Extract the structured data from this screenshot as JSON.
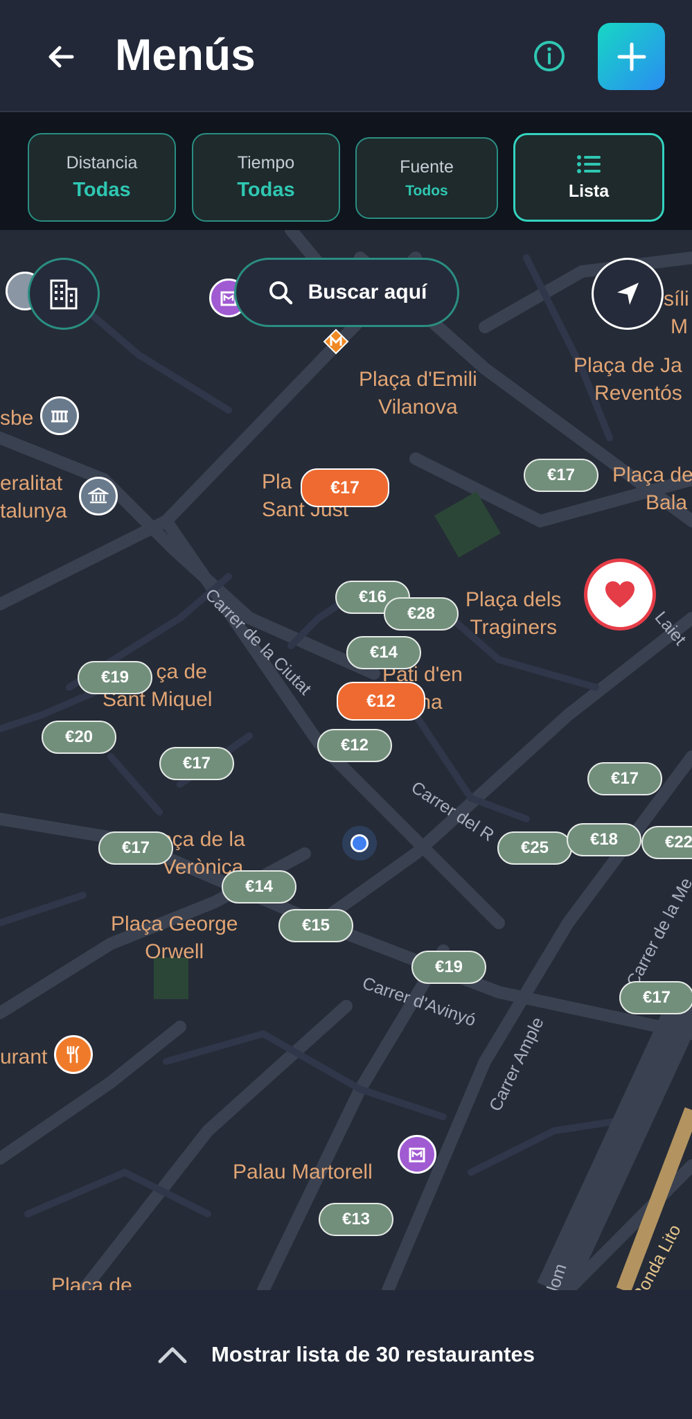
{
  "header": {
    "title": "Menús"
  },
  "filters": [
    {
      "label": "Distancia",
      "value": "Todas"
    },
    {
      "label": "Tiempo",
      "value": "Todas"
    },
    {
      "label": "Fuente",
      "value": "Todos"
    },
    {
      "value": "Lista"
    }
  ],
  "search_here": "Buscar aquí",
  "map_labels": {
    "emili_vilanova_1": "Plaça d'Emili",
    "emili_vilanova_2": "Vilanova",
    "jaume_1": "Plaça de Ja",
    "jaume_2": "Reventós",
    "basilica_1": "síli",
    "basilica_2": "M",
    "sbe": "sbe",
    "generalitat_1": "eralitat",
    "generalitat_2": "talunya",
    "sant_just_1": "Pla",
    "sant_just_2": "Sant Just",
    "balagueret_1": "Plaça de",
    "balagueret_2": "Bala",
    "traginers_1": "Plaça dels",
    "traginers_2": "Traginers",
    "sant_miquel_1": "ça de",
    "sant_miquel_2": "Sant Miquel",
    "pati_1": "Pati d'en",
    "pati_2": "iona",
    "veronica_1": "aça de la",
    "veronica_2": "Verònica",
    "george_orwell_1": "Plaça George",
    "george_orwell_2": "Orwell",
    "restaurant": "urant",
    "palau_martorell": "Palau Martorell",
    "placa_bottom": "Plaça de"
  },
  "street_labels": {
    "ciutat": "Carrer de la Ciutat",
    "regomir": "Carrer del R",
    "avinyo": "Carrer d'Avinyó",
    "ample": "Carrer Ample",
    "merce": "Carrer de la Me",
    "laietana": "Laiet",
    "colom": "olom",
    "ronda": "Ronda Lito"
  },
  "prices": [
    {
      "id": "p1",
      "text": "€17",
      "hot": true
    },
    {
      "id": "p2",
      "text": "€17",
      "hot": false
    },
    {
      "id": "p3",
      "text": "€16",
      "hot": false
    },
    {
      "id": "p4",
      "text": "€28",
      "hot": false
    },
    {
      "id": "p5",
      "text": "€14",
      "hot": false
    },
    {
      "id": "p6",
      "text": "€19",
      "hot": false
    },
    {
      "id": "p7",
      "text": "€12",
      "hot": true
    },
    {
      "id": "p8",
      "text": "€20",
      "hot": false
    },
    {
      "id": "p9",
      "text": "€12",
      "hot": false
    },
    {
      "id": "p10",
      "text": "€17",
      "hot": false
    },
    {
      "id": "p11",
      "text": "€17",
      "hot": false
    },
    {
      "id": "p12",
      "text": "€17",
      "hot": false
    },
    {
      "id": "p13",
      "text": "€25",
      "hot": false
    },
    {
      "id": "p14",
      "text": "€18",
      "hot": false
    },
    {
      "id": "p15",
      "text": "€22",
      "hot": false
    },
    {
      "id": "p16",
      "text": "€14",
      "hot": false
    },
    {
      "id": "p17",
      "text": "€15",
      "hot": false
    },
    {
      "id": "p18",
      "text": "€19",
      "hot": false
    },
    {
      "id": "p19",
      "text": "€17",
      "hot": false
    },
    {
      "id": "p20",
      "text": "€13",
      "hot": false
    }
  ],
  "bottom": {
    "label": "Mostrar lista de 30 restaurantes"
  },
  "colors": {
    "accent": "#2fc7b2",
    "hot_price": "#ef6a30",
    "price": "#728f7c",
    "label": "#e2a574",
    "favorite": "#e53d48"
  }
}
